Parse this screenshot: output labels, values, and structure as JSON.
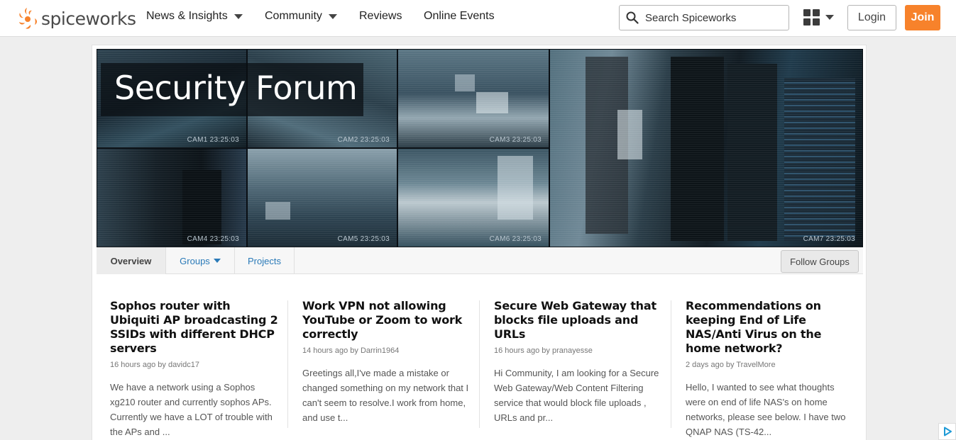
{
  "header": {
    "logo_text": "spiceworks",
    "nav": [
      {
        "label": "News & Insights",
        "dropdown": true
      },
      {
        "label": "Community",
        "dropdown": true
      },
      {
        "label": "Reviews",
        "dropdown": false
      },
      {
        "label": "Online Events",
        "dropdown": false
      }
    ],
    "search_placeholder": "Search Spiceworks",
    "login_label": "Login",
    "join_label": "Join"
  },
  "banner": {
    "title": "Security Forum",
    "cameras": [
      {
        "label": "CAM1  23:25:03"
      },
      {
        "label": "CAM2  23:25:03"
      },
      {
        "label": "CAM3  23:25:03"
      },
      {
        "label": "CAM4  23:25:03"
      },
      {
        "label": "CAM5  23:25:03"
      },
      {
        "label": "CAM6  23:25:03"
      },
      {
        "label": "CAM7  23:25:03"
      }
    ]
  },
  "tabs": {
    "items": [
      {
        "label": "Overview",
        "active": true
      },
      {
        "label": "Groups",
        "dropdown": true
      },
      {
        "label": "Projects"
      }
    ],
    "follow_label": "Follow Groups"
  },
  "topics": [
    {
      "title": "Sophos router with Ubiquiti AP broadcasting 2 SSIDs with different DHCP servers",
      "meta": "16 hours ago by davidc17",
      "excerpt": "We have a network using a Sophos xg210 router and currently sophos APs.  Currently we have a LOT of trouble with the APs and ..."
    },
    {
      "title": "Work VPN not allowing YouTube or Zoom to work correctly",
      "meta": "14 hours ago by Darrin1964",
      "excerpt": "Greetings all,I've made a mistake or changed something on my network that I can't seem to resolve.I work from home, and use t..."
    },
    {
      "title": "Secure Web Gateway that blocks file uploads and URLs",
      "meta": "16 hours ago by pranayesse",
      "excerpt": "Hi Community, I am looking for a Secure Web Gateway/Web Content Filtering service that would block file uploads , URLs and pr..."
    },
    {
      "title": "Recommendations on keeping End of Life NAS/Anti Virus on the home network?",
      "meta": "2 days ago by TravelMore",
      "excerpt": "Hello, I wanted to see what thoughts were on end of life NAS's on home networks, please see below. I have two QNAP NAS (TS-42..."
    }
  ],
  "colors": {
    "brand_orange": "#f7822b",
    "link_blue": "#2a7ab8",
    "banner_dark": "#0d1820"
  }
}
